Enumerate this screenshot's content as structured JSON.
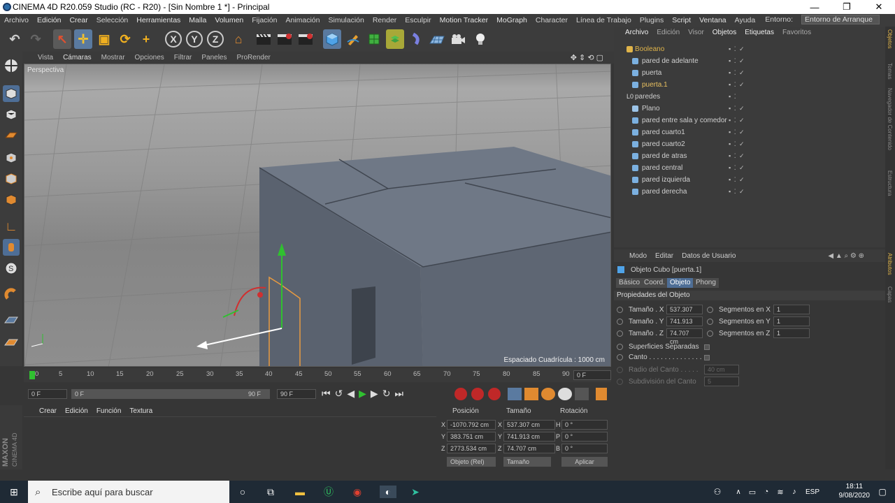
{
  "window": {
    "title": "CINEMA 4D R20.059 Studio (RC - R20) - [Sin Nombre 1 *] - Principal",
    "min": "—",
    "max": "❐",
    "close": "✕"
  },
  "menu": {
    "items": [
      "Archivo",
      "Edición",
      "Crear",
      "Selección",
      "Herramientas",
      "Malla",
      "Volumen",
      "Fijación",
      "Animación",
      "Simulación",
      "Render",
      "Esculpir",
      "Motion Tracker",
      "MoGraph",
      "Character",
      "Línea de Trabajo",
      "Plugins",
      "Script",
      "Ventana",
      "Ayuda"
    ],
    "entorno_label": "Entorno:",
    "entorno_value": "Entorno de Arranque"
  },
  "toolbar": {
    "undo": "↶",
    "redo": "↷",
    "select": "↖",
    "move": "✛",
    "scale": "▣",
    "rotate": "⟳",
    "add": "+",
    "x": "X",
    "y": "Y",
    "z": "Z",
    "coord": "⌂"
  },
  "viewport": {
    "menu": [
      "Vista",
      "Cámaras",
      "Mostrar",
      "Opciones",
      "Filtrar",
      "Paneles",
      "ProRender"
    ],
    "label": "Perspectiva",
    "grid_info": "Espaciado Cuadrícula : 1000 cm"
  },
  "timeline": {
    "ticks": [
      "0",
      "5",
      "10",
      "15",
      "20",
      "25",
      "30",
      "35",
      "40",
      "45",
      "50",
      "55",
      "60",
      "65",
      "70",
      "75",
      "80",
      "85",
      "90"
    ],
    "current": "0 F",
    "end": "0 F"
  },
  "transport": {
    "start": "0 F",
    "range_start": "0 F",
    "range_end": "90 F",
    "end": "90 F"
  },
  "materials": {
    "menu": [
      "Crear",
      "Edición",
      "Función",
      "Textura"
    ]
  },
  "coords": {
    "headers": [
      "Posición",
      "Tamaño",
      "Rotación"
    ],
    "rows": [
      {
        "axis": "X",
        "pos": "-1070.792 cm",
        "size_axis": "X",
        "size": "537.307 cm",
        "rot_axis": "H",
        "rot": "0 °"
      },
      {
        "axis": "Y",
        "pos": "383.751 cm",
        "size_axis": "Y",
        "size": "741.913 cm",
        "rot_axis": "P",
        "rot": "0 °"
      },
      {
        "axis": "Z",
        "pos": "2773.534 cm",
        "size_axis": "Z",
        "size": "74.707 cm",
        "rot_axis": "B",
        "rot": "0 °"
      }
    ],
    "mode": "Objeto (Rel)",
    "size_mode": "Tamaño",
    "apply": "Aplicar"
  },
  "objects": {
    "menu": [
      "Archivo",
      "Edición",
      "Visor",
      "Objetos",
      "Etiquetas",
      "Favoritos"
    ],
    "items": [
      {
        "name": "Booleano",
        "color": "#e0b44a"
      },
      {
        "name": "pared de adelante",
        "color": "#cfd8e0"
      },
      {
        "name": "puerta",
        "color": "#cfd8e0"
      },
      {
        "name": "puerta.1",
        "color": "#e8c060"
      },
      {
        "name": "paredes",
        "color": "#c0c0c0"
      },
      {
        "name": "Plano",
        "color": "#cfd8e0"
      },
      {
        "name": "pared entre sala y comedor",
        "color": "#cfd8e0"
      },
      {
        "name": "pared cuarto1",
        "color": "#cfd8e0"
      },
      {
        "name": "pared cuarto2",
        "color": "#cfd8e0"
      },
      {
        "name": "pared de atras",
        "color": "#cfd8e0"
      },
      {
        "name": "pared central",
        "color": "#cfd8e0"
      },
      {
        "name": "pared izquierda",
        "color": "#cfd8e0"
      },
      {
        "name": "pared derecha",
        "color": "#cfd8e0"
      }
    ]
  },
  "attributes": {
    "menu": [
      "Modo",
      "Editar",
      "Datos de Usuario"
    ],
    "object_title": "Objeto Cubo [puerta.1]",
    "tabs": [
      "Básico",
      "Coord.",
      "Objeto",
      "Phong"
    ],
    "active_tab": "Objeto",
    "section": "Propiedades del Objeto",
    "size_x_label": "Tamaño . X",
    "size_x": "537.307 cı",
    "size_y_label": "Tamaño . Y",
    "size_y": "741.913 cı",
    "size_z_label": "Tamaño . Z",
    "size_z": "74.707 cm",
    "seg_x_label": "Segmentos en X",
    "seg_x": "1",
    "seg_y_label": "Segmentos en Y",
    "seg_y": "1",
    "seg_z_label": "Segmentos en Z",
    "seg_z": "1",
    "separated": "Superficies Separadas",
    "fillet": "Canto . . . . . . . . . . . . . .",
    "fillet_radius_label": "Radio del Canto . . . . .",
    "fillet_radius": "40 cm",
    "fillet_sub_label": "Subdivisión del Canto",
    "fillet_sub": "5"
  },
  "sidebar": {
    "tabs": [
      "Objetos",
      "Tomas",
      "Navegador de Contenido",
      "Estructura",
      "Atributos",
      "Capas"
    ]
  },
  "brand": {
    "maxon": "MAXON",
    "c4d": "CINEMA 4D"
  },
  "taskbar": {
    "search_placeholder": "Escribe aquí para buscar",
    "lang": "ESP",
    "time": "18:11",
    "date": "9/08/2020"
  }
}
